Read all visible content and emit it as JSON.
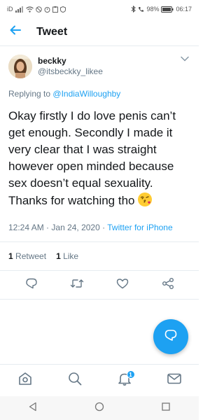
{
  "status_bar": {
    "left_label": "iD",
    "battery": "98%",
    "time": "06:17"
  },
  "app_bar": {
    "title": "Tweet"
  },
  "tweet": {
    "display_name": "beckky",
    "handle": "@itsbeckky_likee",
    "replying_prefix": "Replying to",
    "replying_user": "@IndiaWilloughby",
    "text": "Okay firstly I do love penis can’t get enough. Secondly I made it very clear that I was straight however open minded because sex doesn’t equal sexuality. Thanks for watching tho",
    "emoji": "face-blowing-kiss",
    "time": "12:24 AM",
    "date": "Jan 24, 2020",
    "source": "Twitter for iPhone",
    "retweets_count": "1",
    "retweets_label": "Retweet",
    "likes_count": "1",
    "likes_label": "Like"
  },
  "bottom_nav": {
    "notifications_badge": "1"
  },
  "colors": {
    "accent": "#1da1f2",
    "secondary_text": "#657786",
    "divider": "#e6ecf0"
  }
}
